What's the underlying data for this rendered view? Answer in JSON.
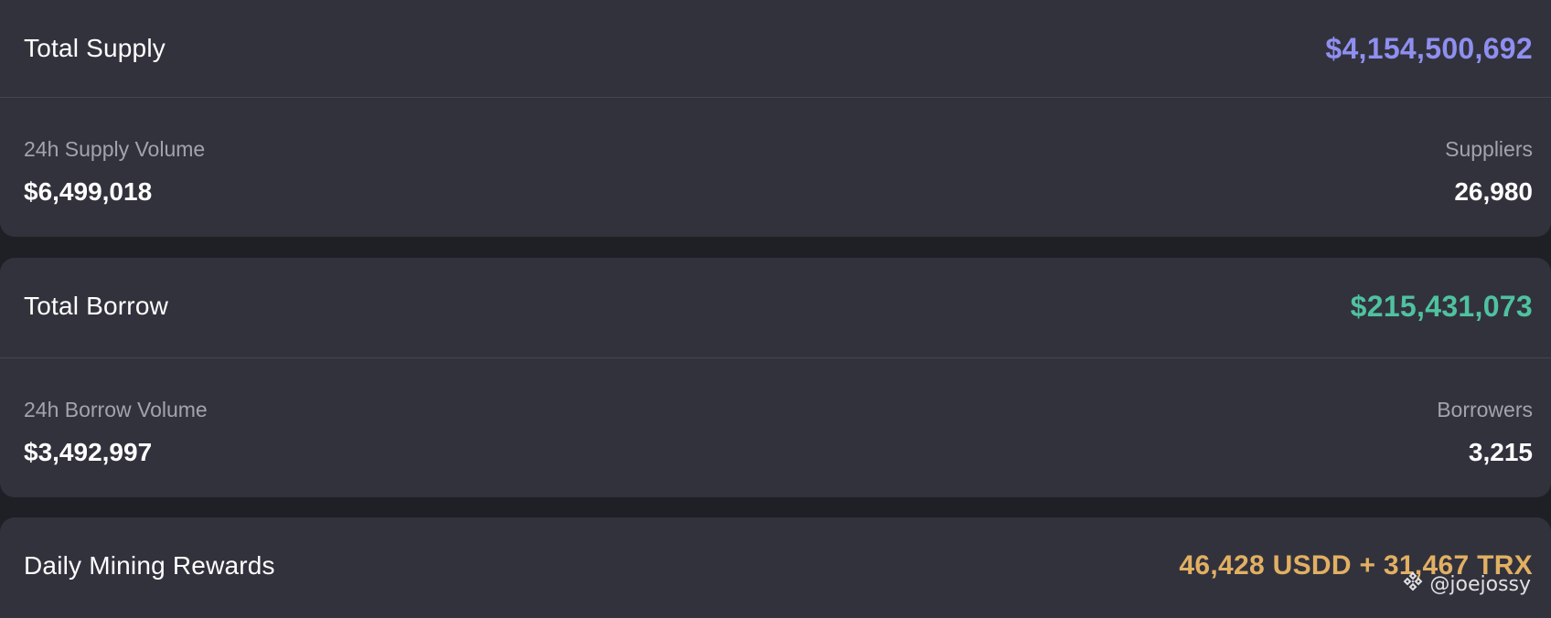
{
  "supply": {
    "title": "Total Supply",
    "total": "$4,154,500,692",
    "total_color": "#8f8ff0",
    "volume_label": "24h Supply Volume",
    "volume_value": "$6,499,018",
    "count_label": "Suppliers",
    "count_value": "26,980"
  },
  "borrow": {
    "title": "Total Borrow",
    "total": "$215,431,073",
    "total_color": "#4fc2a0",
    "volume_label": "24h Borrow Volume",
    "volume_value": "$3,492,997",
    "count_label": "Borrowers",
    "count_value": "3,215"
  },
  "rewards": {
    "title": "Daily Mining Rewards",
    "value": "46,428 USDD + 31,467 TRX",
    "value_color": "#e2b062"
  },
  "watermark": {
    "icon": "binance-logo-icon",
    "text": "@joejossy"
  }
}
